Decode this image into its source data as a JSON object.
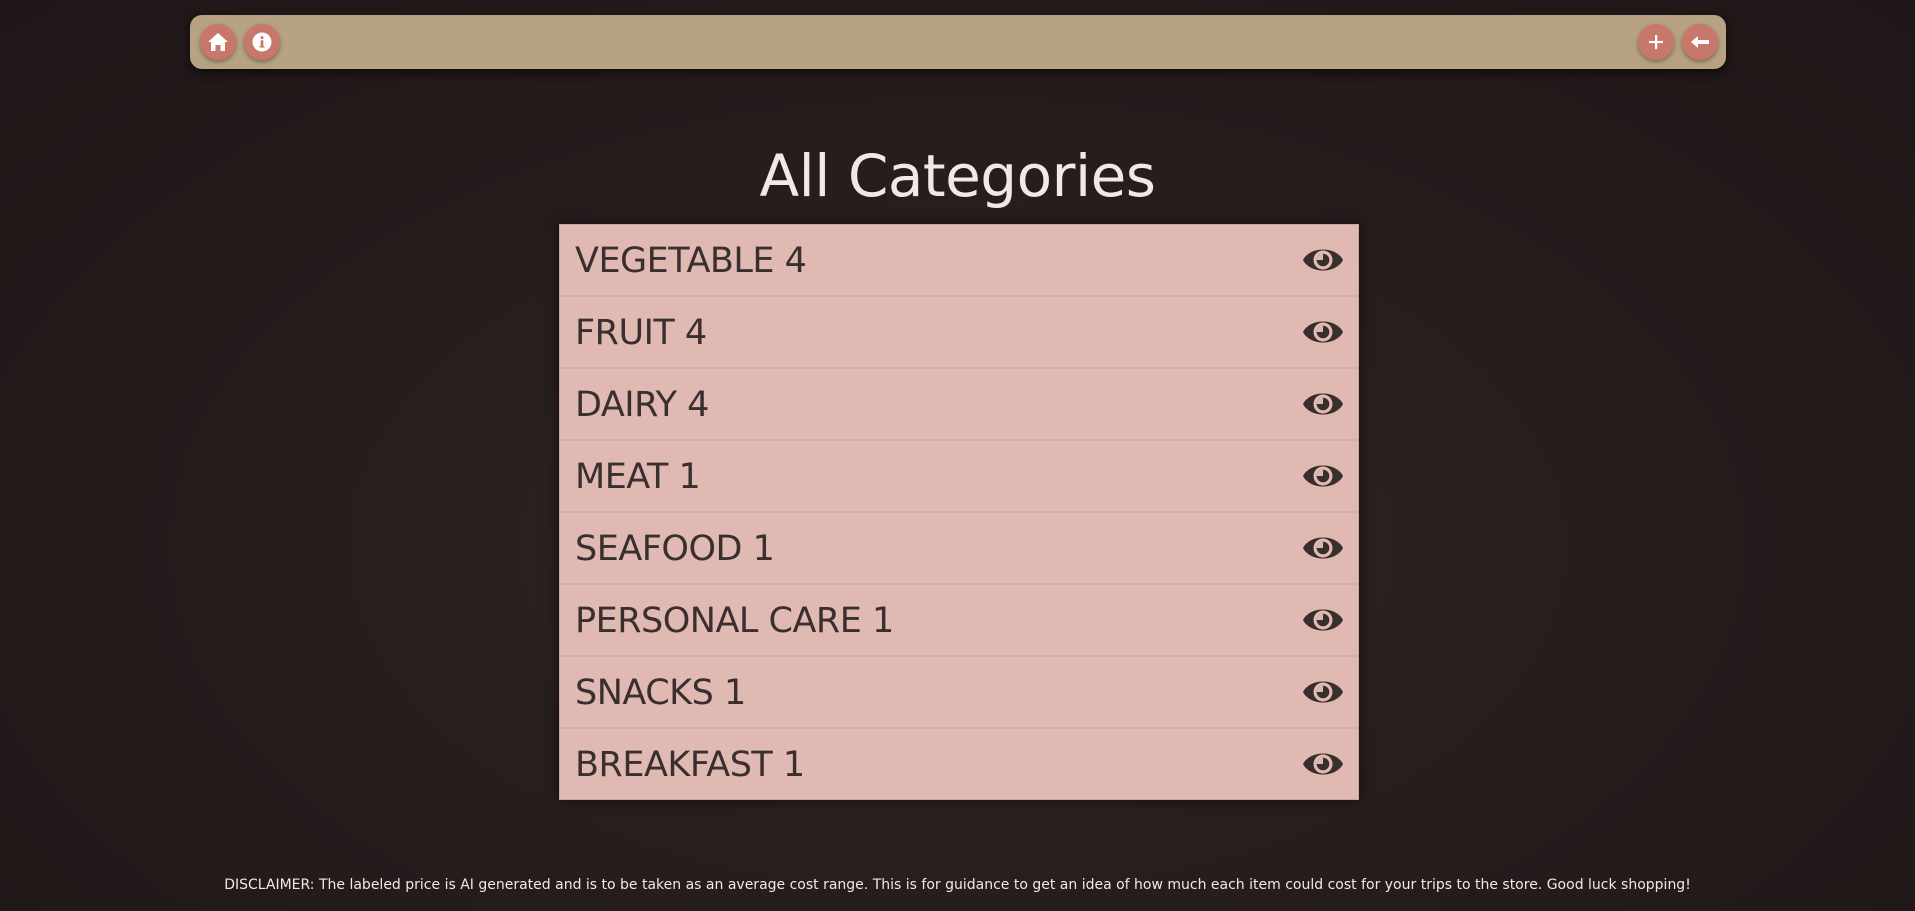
{
  "nav": {
    "home_icon": "home-icon",
    "info_icon": "info-icon",
    "add_icon": "plus-icon",
    "back_icon": "arrow-left-icon",
    "bar_color": "#b7a283",
    "button_color": "#c8786b"
  },
  "page": {
    "title": "All Categories"
  },
  "categories": [
    {
      "label": "VEGETABLE 4",
      "icon": "eye-icon"
    },
    {
      "label": "FRUIT 4",
      "icon": "eye-icon"
    },
    {
      "label": "DAIRY 4",
      "icon": "eye-icon"
    },
    {
      "label": "MEAT 1",
      "icon": "eye-icon"
    },
    {
      "label": "SEAFOOD 1",
      "icon": "eye-icon"
    },
    {
      "label": "PERSONAL CARE 1",
      "icon": "eye-icon"
    },
    {
      "label": "SNACKS 1",
      "icon": "eye-icon"
    },
    {
      "label": "BREAKFAST 1",
      "icon": "eye-icon"
    }
  ],
  "footer": {
    "disclaimer": "DISCLAIMER: The labeled price is AI generated and is to be taken as an average cost range. This is for guidance to get an idea of how much each item could cost for your trips to the store. Good luck shopping!"
  },
  "colors": {
    "background": "#251c1c",
    "list_background": "#e0bab2",
    "list_text": "#3a2f2f",
    "title_text": "#f3e8e4"
  }
}
